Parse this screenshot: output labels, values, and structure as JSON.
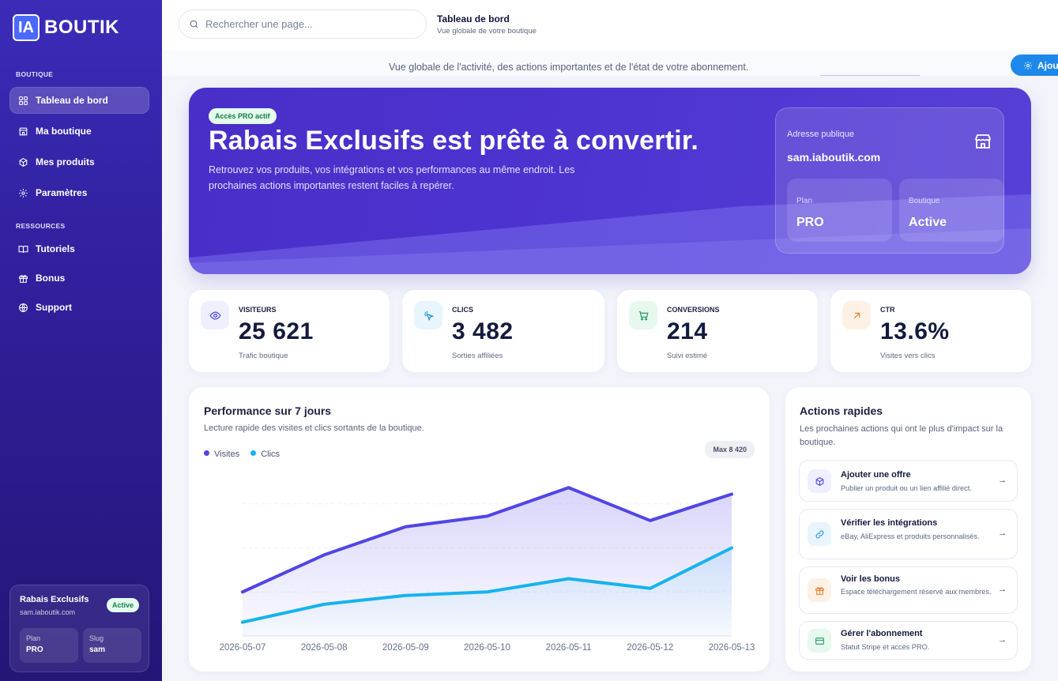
{
  "brand": {
    "logo_box": "IA",
    "logo_text": "BOUTIK"
  },
  "sidebar": {
    "section_boutique": "BOUTIQUE",
    "section_ressources": "RESSOURCES",
    "items": [
      {
        "label": "Tableau de bord",
        "icon": "grid-icon",
        "active": true
      },
      {
        "label": "Ma boutique",
        "icon": "store-icon"
      },
      {
        "label": "Mes produits",
        "icon": "box-icon"
      },
      {
        "label": "Paramètres",
        "icon": "gear-icon"
      },
      {
        "label": "Tutoriels",
        "icon": "book-icon"
      },
      {
        "label": "Bonus",
        "icon": "gift-icon"
      },
      {
        "label": "Support",
        "icon": "globe-icon"
      }
    ],
    "store_card": {
      "name": "Rabais Exclusifs",
      "url": "sam.iaboutik.com",
      "status": "Active",
      "plan_label": "Plan",
      "plan_value": "PRO",
      "slug_label": "Slug",
      "slug_value": "sam"
    }
  },
  "topbar": {
    "search_placeholder": "Rechercher une page...",
    "title": "Tableau de bord",
    "subtitle": "Vue globale de votre boutique"
  },
  "page_subtitle": "Vue globale de l'activité, des actions importantes et de l'état de votre abonnement.",
  "add_button": "Ajou",
  "hero": {
    "badge": "Accès PRO actif",
    "title": "Rabais Exclusifs est prête à convertir.",
    "description": "Retrouvez vos produits, vos intégrations et vos performances au même endroit. Les prochaines actions importantes restent faciles à repérer.",
    "address_label": "Adresse publique",
    "address": "sam.iaboutik.com",
    "plan_label": "Plan",
    "plan_value": "PRO",
    "shop_label": "Boutique",
    "shop_value": "Active"
  },
  "stats": [
    {
      "label": "VISITEURS",
      "value": "25 621",
      "sub": "Trafic boutique",
      "icon": "eye-icon",
      "color": "#4f46e5",
      "bg": "#eef0ff"
    },
    {
      "label": "CLICS",
      "value": "3 482",
      "sub": "Sorties affiliées",
      "icon": "click-icon",
      "color": "#1d8fd8",
      "bg": "#e9f5fd"
    },
    {
      "label": "CONVERSIONS",
      "value": "214",
      "sub": "Suivi estimé",
      "icon": "cart-icon",
      "color": "#1f9d62",
      "bg": "#e7f8ef"
    },
    {
      "label": "CTR",
      "value": "13.6%",
      "sub": "Visites vers clics",
      "icon": "arrow-up-right-icon",
      "color": "#e8833a",
      "bg": "#fdf1e6"
    }
  ],
  "performance": {
    "title": "Performance sur 7 jours",
    "description": "Lecture rapide des visites et clics sortants de la boutique.",
    "max_label": "Max 8 420"
  },
  "chart_data": {
    "type": "area",
    "categories": [
      "2026-05-07",
      "2026-05-08",
      "2026-05-09",
      "2026-05-10",
      "2026-05-11",
      "2026-05-12",
      "2026-05-13"
    ],
    "series": [
      {
        "name": "Visites",
        "color": "#5145e5",
        "values": [
          2500,
          4600,
          6200,
          6800,
          8420,
          6550,
          8050
        ]
      },
      {
        "name": "Clics",
        "color": "#16b3ec",
        "values": [
          780,
          1800,
          2300,
          2500,
          3250,
          2700,
          5000
        ]
      }
    ],
    "ylim": [
      0,
      10000
    ],
    "grid": true,
    "legend": "top-left"
  },
  "actions": {
    "title": "Actions rapides",
    "description": "Les prochaines actions qui ont le plus d'impact sur la boutique.",
    "items": [
      {
        "title": "Ajouter une offre",
        "sub": "Publier un produit ou un lien affilié direct.",
        "icon": "cube-icon",
        "color": "#4f46e5",
        "bg": "#eef0ff"
      },
      {
        "title": "Vérifier les intégrations",
        "sub": "eBay, AliExpress et produits personnalisés.",
        "icon": "link-icon",
        "color": "#1d8fd8",
        "bg": "#e9f5fd"
      },
      {
        "title": "Voir les bonus",
        "sub": "Espace téléchargement réservé aux membres.",
        "icon": "gift-icon",
        "color": "#e8833a",
        "bg": "#fdf1e6"
      },
      {
        "title": "Gérer l'abonnement",
        "sub": "Statut Stripe et accès PRO.",
        "icon": "card-icon",
        "color": "#1f9d62",
        "bg": "#e7f8ef"
      }
    ],
    "arrow": "→"
  }
}
